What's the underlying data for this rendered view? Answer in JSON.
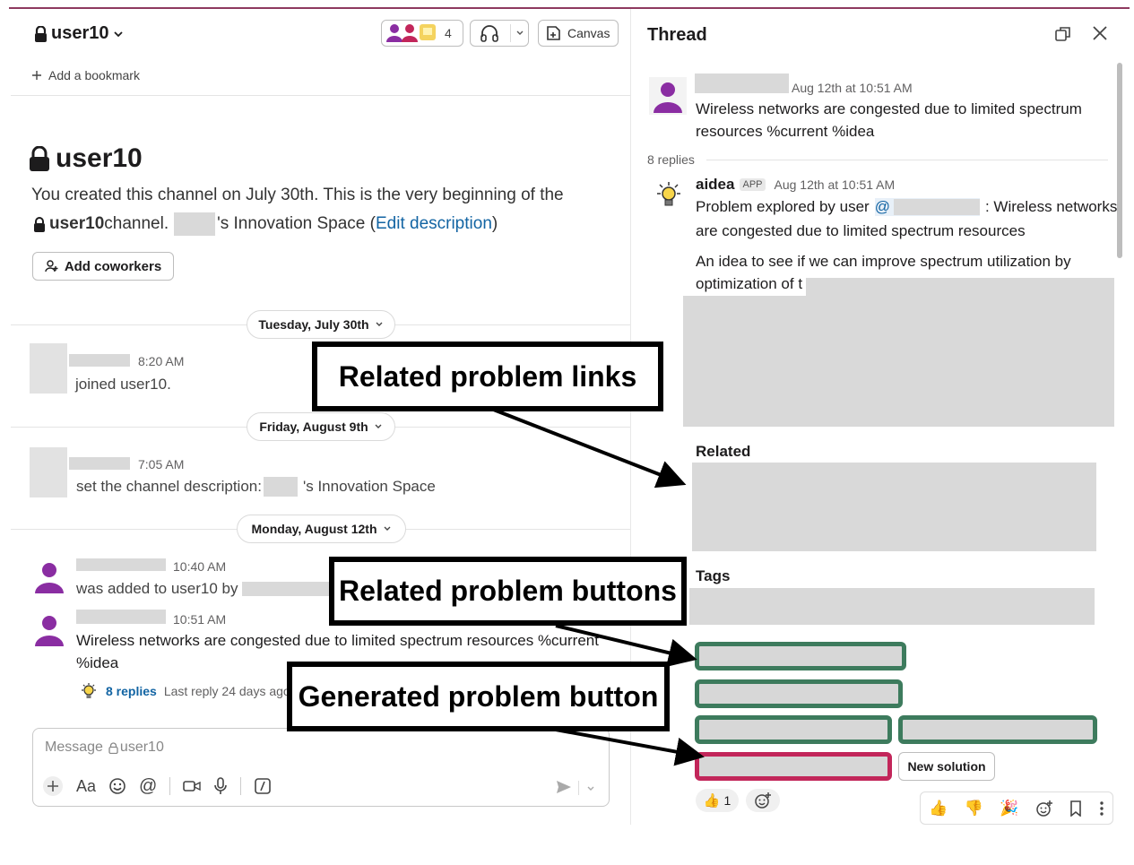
{
  "header": {
    "channel_name": "user10",
    "member_count": "4",
    "canvas_label": "Canvas",
    "bookmark_label": "Add a bookmark"
  },
  "intro": {
    "title": "user10",
    "line1": "You created this channel on July 30th. This is the very beginning of the",
    "channel_ref": "user10",
    "channel_suffix": " channel.",
    "space_text": "'s Innovation Space (",
    "edit_link": "Edit description",
    "close_paren": ")",
    "add_coworkers": "Add coworkers"
  },
  "dates": {
    "d1": "Tuesday, July 30th",
    "d2": "Friday, August 9th",
    "d3": "Monday, August 12th"
  },
  "messages": [
    {
      "time": "8:20 AM",
      "text": "joined user10."
    },
    {
      "time": "7:05 AM",
      "text_prefix": "set the channel description:",
      "text_suffix": "'s Innovation Space"
    },
    {
      "time": "10:40 AM",
      "text": "was added to user10 by"
    },
    {
      "time": "10:51 AM",
      "text_line1": "Wireless networks are congested due to limited spectrum resources %current",
      "text_line2": "%idea",
      "replies": "8 replies",
      "last_reply": "Last reply 24 days ago"
    }
  ],
  "composer": {
    "placeholder_prefix": "Message",
    "placeholder_channel": "user10"
  },
  "thread": {
    "title": "Thread",
    "root_time": "Aug 12th at 10:51 AM",
    "root_line1": "Wireless networks are congested due to limited spectrum",
    "root_line2": "resources %current %idea",
    "replies_count": "8 replies",
    "bot_name": "aidea",
    "app_badge": "APP",
    "bot_time": "Aug 12th at 10:51 AM",
    "bot_line1_prefix": "Problem explored by user",
    "mention_at": "@",
    "bot_line1_suffix": ": Wireless networks",
    "bot_line2": "are congested due to limited spectrum resources",
    "idea_line1": "An idea to see if we can improve spectrum utilization by",
    "idea_line2": "optimization of t",
    "related_heading": "Related",
    "tags_heading": "Tags",
    "new_solution": "New solution",
    "thumbs_count": "1"
  },
  "callouts": {
    "links": "Related problem links",
    "buttons": "Related problem buttons",
    "generated": "Generated problem button"
  },
  "colors": {
    "accent_link": "#1264a3",
    "green_border": "#3d7b5d",
    "red_border": "#c2265a",
    "avatar_purple": "#8a2da2"
  }
}
